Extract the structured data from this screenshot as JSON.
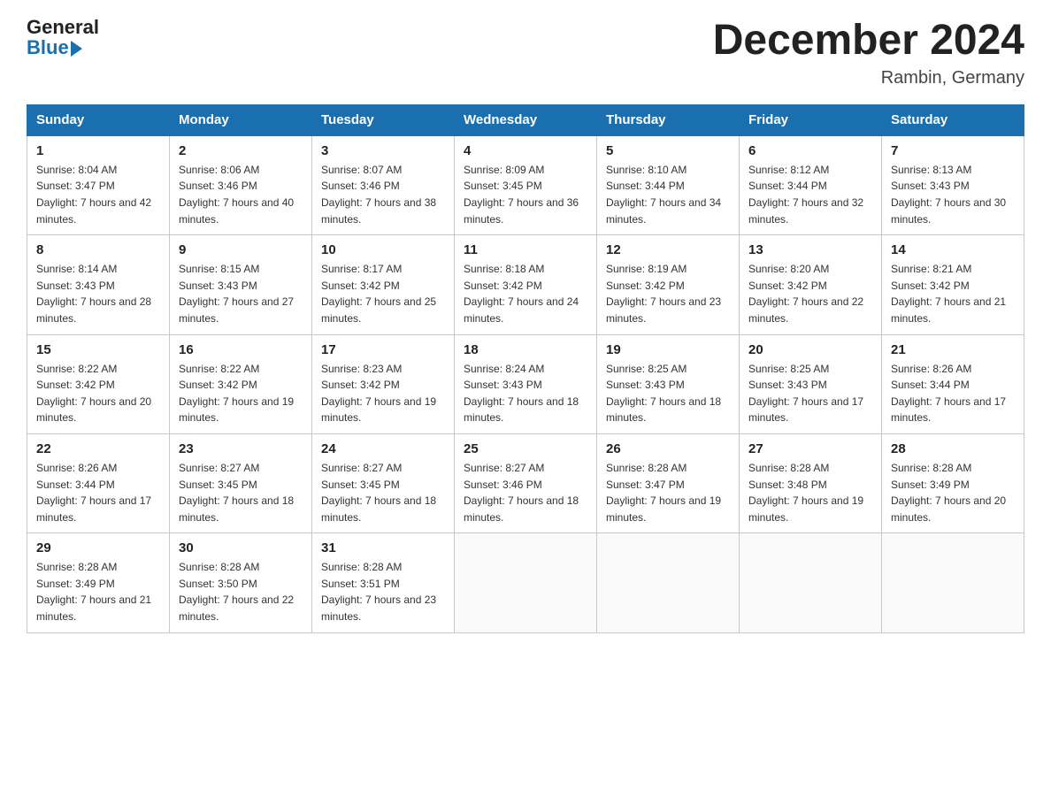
{
  "header": {
    "logo_general": "General",
    "logo_blue": "Blue",
    "month_title": "December 2024",
    "location": "Rambin, Germany"
  },
  "days_of_week": [
    "Sunday",
    "Monday",
    "Tuesday",
    "Wednesday",
    "Thursday",
    "Friday",
    "Saturday"
  ],
  "weeks": [
    [
      {
        "day": "1",
        "sunrise": "8:04 AM",
        "sunset": "3:47 PM",
        "daylight": "7 hours and 42 minutes."
      },
      {
        "day": "2",
        "sunrise": "8:06 AM",
        "sunset": "3:46 PM",
        "daylight": "7 hours and 40 minutes."
      },
      {
        "day": "3",
        "sunrise": "8:07 AM",
        "sunset": "3:46 PM",
        "daylight": "7 hours and 38 minutes."
      },
      {
        "day": "4",
        "sunrise": "8:09 AM",
        "sunset": "3:45 PM",
        "daylight": "7 hours and 36 minutes."
      },
      {
        "day": "5",
        "sunrise": "8:10 AM",
        "sunset": "3:44 PM",
        "daylight": "7 hours and 34 minutes."
      },
      {
        "day": "6",
        "sunrise": "8:12 AM",
        "sunset": "3:44 PM",
        "daylight": "7 hours and 32 minutes."
      },
      {
        "day": "7",
        "sunrise": "8:13 AM",
        "sunset": "3:43 PM",
        "daylight": "7 hours and 30 minutes."
      }
    ],
    [
      {
        "day": "8",
        "sunrise": "8:14 AM",
        "sunset": "3:43 PM",
        "daylight": "7 hours and 28 minutes."
      },
      {
        "day": "9",
        "sunrise": "8:15 AM",
        "sunset": "3:43 PM",
        "daylight": "7 hours and 27 minutes."
      },
      {
        "day": "10",
        "sunrise": "8:17 AM",
        "sunset": "3:42 PM",
        "daylight": "7 hours and 25 minutes."
      },
      {
        "day": "11",
        "sunrise": "8:18 AM",
        "sunset": "3:42 PM",
        "daylight": "7 hours and 24 minutes."
      },
      {
        "day": "12",
        "sunrise": "8:19 AM",
        "sunset": "3:42 PM",
        "daylight": "7 hours and 23 minutes."
      },
      {
        "day": "13",
        "sunrise": "8:20 AM",
        "sunset": "3:42 PM",
        "daylight": "7 hours and 22 minutes."
      },
      {
        "day": "14",
        "sunrise": "8:21 AM",
        "sunset": "3:42 PM",
        "daylight": "7 hours and 21 minutes."
      }
    ],
    [
      {
        "day": "15",
        "sunrise": "8:22 AM",
        "sunset": "3:42 PM",
        "daylight": "7 hours and 20 minutes."
      },
      {
        "day": "16",
        "sunrise": "8:22 AM",
        "sunset": "3:42 PM",
        "daylight": "7 hours and 19 minutes."
      },
      {
        "day": "17",
        "sunrise": "8:23 AM",
        "sunset": "3:42 PM",
        "daylight": "7 hours and 19 minutes."
      },
      {
        "day": "18",
        "sunrise": "8:24 AM",
        "sunset": "3:43 PM",
        "daylight": "7 hours and 18 minutes."
      },
      {
        "day": "19",
        "sunrise": "8:25 AM",
        "sunset": "3:43 PM",
        "daylight": "7 hours and 18 minutes."
      },
      {
        "day": "20",
        "sunrise": "8:25 AM",
        "sunset": "3:43 PM",
        "daylight": "7 hours and 17 minutes."
      },
      {
        "day": "21",
        "sunrise": "8:26 AM",
        "sunset": "3:44 PM",
        "daylight": "7 hours and 17 minutes."
      }
    ],
    [
      {
        "day": "22",
        "sunrise": "8:26 AM",
        "sunset": "3:44 PM",
        "daylight": "7 hours and 17 minutes."
      },
      {
        "day": "23",
        "sunrise": "8:27 AM",
        "sunset": "3:45 PM",
        "daylight": "7 hours and 18 minutes."
      },
      {
        "day": "24",
        "sunrise": "8:27 AM",
        "sunset": "3:45 PM",
        "daylight": "7 hours and 18 minutes."
      },
      {
        "day": "25",
        "sunrise": "8:27 AM",
        "sunset": "3:46 PM",
        "daylight": "7 hours and 18 minutes."
      },
      {
        "day": "26",
        "sunrise": "8:28 AM",
        "sunset": "3:47 PM",
        "daylight": "7 hours and 19 minutes."
      },
      {
        "day": "27",
        "sunrise": "8:28 AM",
        "sunset": "3:48 PM",
        "daylight": "7 hours and 19 minutes."
      },
      {
        "day": "28",
        "sunrise": "8:28 AM",
        "sunset": "3:49 PM",
        "daylight": "7 hours and 20 minutes."
      }
    ],
    [
      {
        "day": "29",
        "sunrise": "8:28 AM",
        "sunset": "3:49 PM",
        "daylight": "7 hours and 21 minutes."
      },
      {
        "day": "30",
        "sunrise": "8:28 AM",
        "sunset": "3:50 PM",
        "daylight": "7 hours and 22 minutes."
      },
      {
        "day": "31",
        "sunrise": "8:28 AM",
        "sunset": "3:51 PM",
        "daylight": "7 hours and 23 minutes."
      },
      null,
      null,
      null,
      null
    ]
  ]
}
